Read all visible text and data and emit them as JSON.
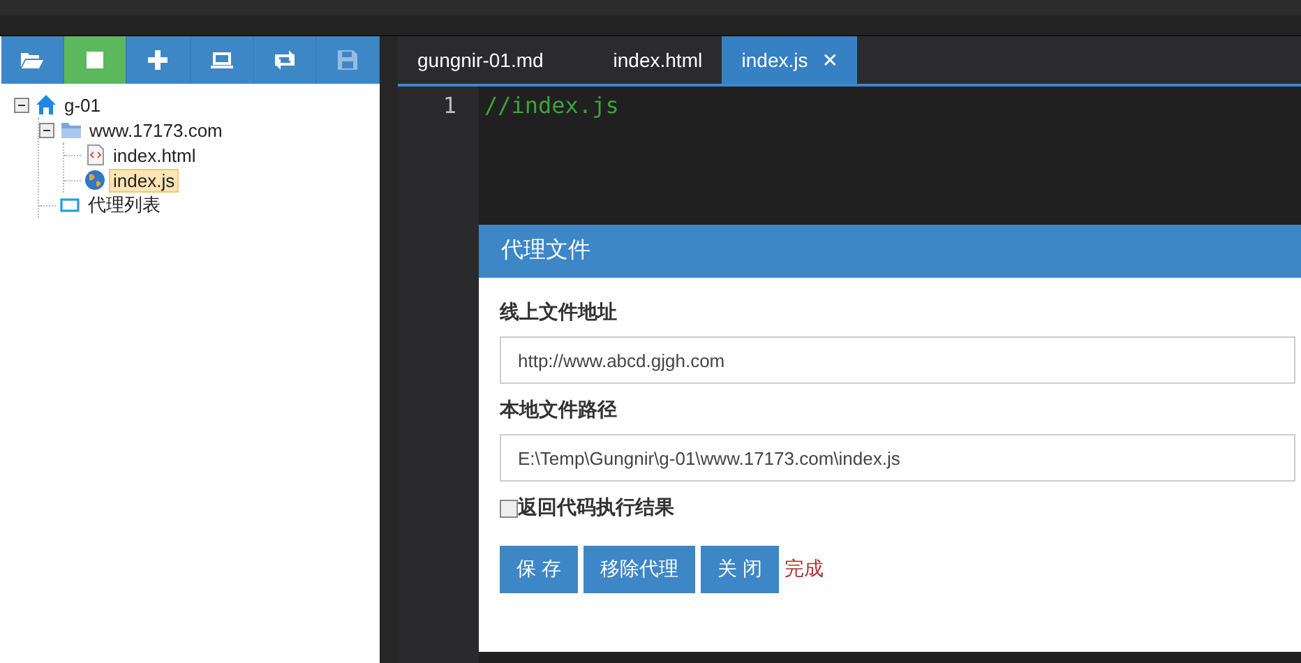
{
  "toolbar": [
    {
      "kind": "open",
      "active": false,
      "disabled": false
    },
    {
      "kind": "stop",
      "active": true,
      "disabled": false
    },
    {
      "kind": "add",
      "active": false,
      "disabled": false
    },
    {
      "kind": "laptop",
      "active": false,
      "disabled": false
    },
    {
      "kind": "sync",
      "active": false,
      "disabled": false
    },
    {
      "kind": "save",
      "active": false,
      "disabled": true
    }
  ],
  "tree": [
    {
      "label": "g-01",
      "kind": "home",
      "expanded": true,
      "selected": false,
      "children": [
        {
          "label": "www.17173.com",
          "kind": "folder",
          "expanded": true,
          "selected": false,
          "children": [
            {
              "label": "index.html",
              "kind": "html",
              "selected": false
            },
            {
              "label": "index.js",
              "kind": "js",
              "selected": true
            }
          ]
        },
        {
          "label": "代理列表",
          "kind": "proxy",
          "selected": false
        }
      ]
    }
  ],
  "tabs": [
    {
      "label": "gungnir-01.md",
      "selected": false
    },
    {
      "label": "index.html",
      "selected": false
    },
    {
      "label": "index.js",
      "selected": true,
      "close": "✕"
    }
  ],
  "editor": {
    "lines": [
      {
        "number": "1",
        "code": "//index.js"
      }
    ]
  },
  "dialog": {
    "title": "代理文件",
    "fields": [
      {
        "label": "线上文件地址",
        "value": "http://www.abcd.gjgh.com"
      },
      {
        "label": "本地文件路径",
        "value": "E:\\Temp\\Gungnir\\g-01\\www.17173.com\\index.js"
      }
    ],
    "checkbox": {
      "label": "返回代码执行结果",
      "checked": false
    },
    "buttons": [
      "保 存",
      "移除代理",
      "关 闭"
    ],
    "status": "完成"
  }
}
